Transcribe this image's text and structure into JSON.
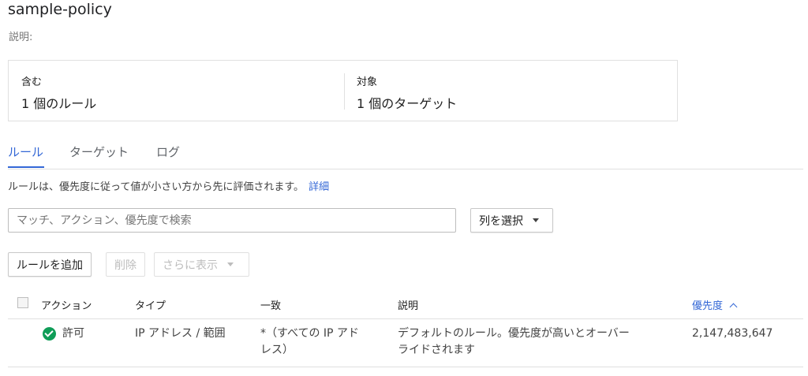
{
  "policy": {
    "name": "sample-policy",
    "description_label": "説明:"
  },
  "summary": {
    "includes_label": "含む",
    "includes_value": "1 個のルール",
    "targets_label": "対象",
    "targets_value": "1 個のターゲット"
  },
  "tabs": [
    {
      "label": "ルール"
    },
    {
      "label": "ターゲット"
    },
    {
      "label": "ログ"
    }
  ],
  "info": {
    "text": "ルールは、優先度に従って値が小さい方から先に評価されます。",
    "link": "詳細"
  },
  "filter": {
    "placeholder": "マッチ、アクション、優先度で検索",
    "value": ""
  },
  "columns_button": "列を選択",
  "toolbar": {
    "add_rule": "ルールを追加",
    "delete": "削除",
    "more": "さらに表示"
  },
  "table": {
    "headers": {
      "action": "アクション",
      "type": "タイプ",
      "match": "一致",
      "description": "説明",
      "priority": "優先度"
    },
    "rows": [
      {
        "action": "許可",
        "type": "IP アドレス / 範囲",
        "match_line1": "*（すべての IP アド",
        "match_line2": "レス）",
        "description_line1": "デフォルトのルール。優先度が高いとオーバー",
        "description_line2": "ライドされます",
        "priority": "2,147,483,647"
      }
    ]
  },
  "colors": {
    "accent": "#3367d6",
    "allow": "#0f9d58"
  }
}
